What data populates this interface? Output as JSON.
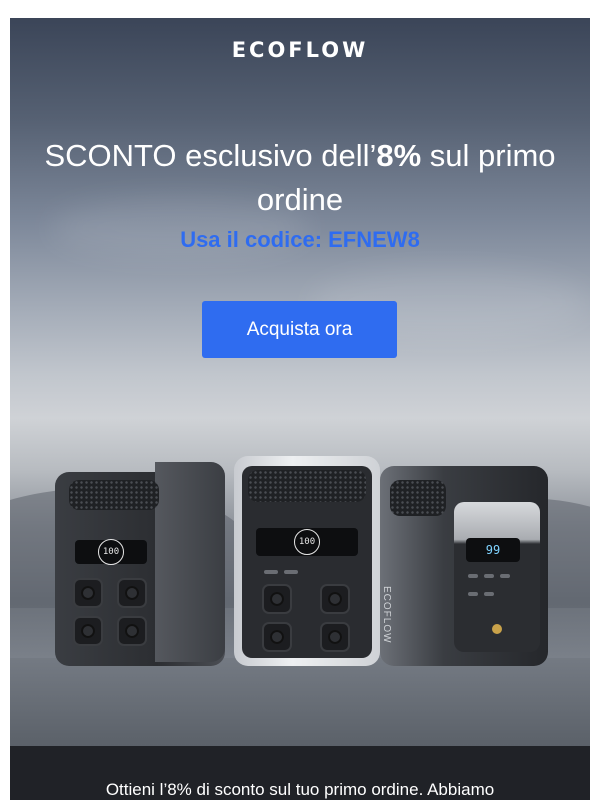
{
  "email": {
    "logo": "ECOFLOW",
    "headline_part1": "SCONTO esclusivo dell’",
    "headline_highlight": "8%",
    "headline_part2": " sul primo ordine",
    "code_line": "Usa il codice: EFNEW8",
    "cta_label": "Acquista ora",
    "info_text": "Ottieni l’8% di sconto sul tuo primo ordine. Abbiamo",
    "products": {
      "left_display": "100",
      "center_display": "100",
      "right_display": "99",
      "brand_side": "ECOFLOW"
    },
    "colors": {
      "accent": "#2f6cf0",
      "dark_band": "#202227"
    }
  }
}
